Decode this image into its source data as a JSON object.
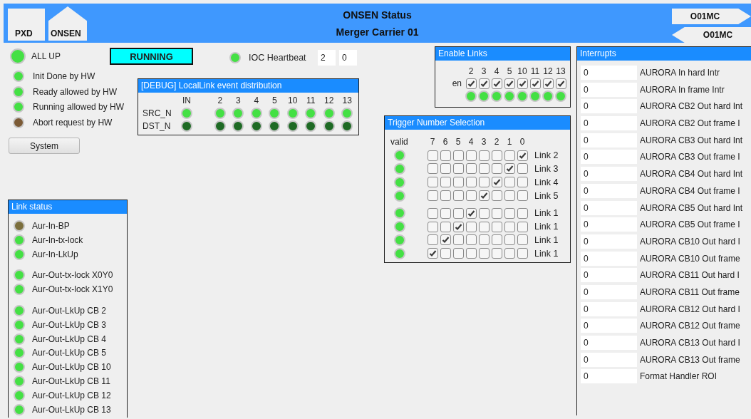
{
  "header": {
    "buttons": [
      {
        "kind": "square",
        "label": "PXD"
      },
      {
        "kind": "house",
        "label": "ONSEN"
      }
    ],
    "title": "ONSEN Status",
    "subtitle": "Merger Carrier 01",
    "nav": [
      {
        "kind": "next",
        "label": "O01MC"
      },
      {
        "kind": "prev",
        "label": "O01MC"
      }
    ]
  },
  "status": {
    "all_up": {
      "label": "ALL UP",
      "color": "#44e044"
    },
    "state": "RUNNING",
    "indicators": [
      {
        "label": "Init Done by HW",
        "color": "#44e044"
      },
      {
        "label": "Ready allowed by HW",
        "color": "#44e044"
      },
      {
        "label": "Running allowed by HW",
        "color": "#44e044"
      },
      {
        "label": "Abort request by HW",
        "color": "#7b5a35"
      }
    ],
    "button": "System"
  },
  "heartbeat": {
    "label": "IOC Heartbeat",
    "color": "#44e044",
    "values": [
      "2",
      "0"
    ]
  },
  "debug_panel": {
    "title": "[DEBUG] LocalLink event distribution",
    "columns": [
      "IN",
      "2",
      "3",
      "4",
      "5",
      "10",
      "11",
      "12",
      "13"
    ],
    "rows": [
      {
        "label": "SRC_N",
        "leds": [
          {
            "color": "#44e044"
          },
          {
            "color": "#44e044"
          },
          {
            "color": "#44e044"
          },
          {
            "color": "#44e044"
          },
          {
            "color": "#44e044"
          },
          {
            "color": "#44e044"
          },
          {
            "color": "#44e044"
          },
          {
            "color": "#44e044"
          },
          {
            "color": "#44e044"
          }
        ]
      },
      {
        "label": "DST_N",
        "leds": [
          {
            "color": "#1e6a24"
          },
          {
            "color": "#1e6a24"
          },
          {
            "color": "#1e6a24"
          },
          {
            "color": "#1e6a24"
          },
          {
            "color": "#1e6a24"
          },
          {
            "color": "#1e6a24"
          },
          {
            "color": "#1e6a24"
          },
          {
            "color": "#1e6a24"
          },
          {
            "color": "#1e6a24"
          }
        ]
      }
    ]
  },
  "link_status": {
    "title": "Link status",
    "groups": [
      [
        {
          "label": "Aur-In-BP",
          "color": "#7b6e3c"
        },
        {
          "label": "Aur-In-tx-lock",
          "color": "#44e044"
        },
        {
          "label": "Aur-In-LkUp",
          "color": "#44e044"
        }
      ],
      [
        {
          "label": "Aur-Out-tx-lock X0Y0",
          "color": "#44e044"
        },
        {
          "label": "Aur-Out-tx-lock X1Y0",
          "color": "#44e044"
        }
      ],
      [
        {
          "label": "Aur-Out-LkUp CB 2",
          "color": "#44e044"
        },
        {
          "label": "Aur-Out-LkUp CB 3",
          "color": "#44e044"
        },
        {
          "label": "Aur-Out-LkUp CB 4",
          "color": "#44e044"
        },
        {
          "label": "Aur-Out-LkUp CB 5",
          "color": "#44e044"
        },
        {
          "label": "Aur-Out-LkUp CB 10",
          "color": "#44e044"
        },
        {
          "label": "Aur-Out-LkUp CB 11",
          "color": "#44e044"
        },
        {
          "label": "Aur-Out-LkUp CB 12",
          "color": "#44e044"
        },
        {
          "label": "Aur-Out-LkUp CB 13",
          "color": "#44e044"
        }
      ]
    ]
  },
  "enable_links": {
    "title": "Enable Links",
    "row_label": "en",
    "links": [
      {
        "label": "2",
        "checked": true,
        "color": "#44e044"
      },
      {
        "label": "3",
        "checked": true,
        "color": "#44e044"
      },
      {
        "label": "4",
        "checked": true,
        "color": "#44e044"
      },
      {
        "label": "5",
        "checked": true,
        "color": "#44e044"
      },
      {
        "label": "10",
        "checked": true,
        "color": "#44e044"
      },
      {
        "label": "11",
        "checked": true,
        "color": "#44e044"
      },
      {
        "label": "12",
        "checked": true,
        "color": "#44e044"
      },
      {
        "label": "13",
        "checked": true,
        "color": "#44e044"
      }
    ]
  },
  "trigger_selection": {
    "title": "Trigger Number Selection",
    "valid_label": "valid",
    "bits": [
      "7",
      "6",
      "5",
      "4",
      "3",
      "2",
      "1",
      "0"
    ],
    "groups": [
      [
        {
          "label": "Link 2",
          "color": "#44e044",
          "checked": [
            false,
            false,
            false,
            false,
            false,
            false,
            false,
            true
          ]
        },
        {
          "label": "Link 3",
          "color": "#44e044",
          "checked": [
            false,
            false,
            false,
            false,
            false,
            false,
            true,
            false
          ]
        },
        {
          "label": "Link 4",
          "color": "#44e044",
          "checked": [
            false,
            false,
            false,
            false,
            false,
            true,
            false,
            false
          ]
        },
        {
          "label": "Link 5",
          "color": "#44e044",
          "checked": [
            false,
            false,
            false,
            false,
            true,
            false,
            false,
            false
          ]
        }
      ],
      [
        {
          "label": "Link 1",
          "color": "#44e044",
          "checked": [
            false,
            false,
            false,
            true,
            false,
            false,
            false,
            false
          ]
        },
        {
          "label": "Link 1",
          "color": "#44e044",
          "checked": [
            false,
            false,
            true,
            false,
            false,
            false,
            false,
            false
          ]
        },
        {
          "label": "Link 1",
          "color": "#44e044",
          "checked": [
            false,
            true,
            false,
            false,
            false,
            false,
            false,
            false
          ]
        },
        {
          "label": "Link 1",
          "color": "#44e044",
          "checked": [
            true,
            false,
            false,
            false,
            false,
            false,
            false,
            false
          ]
        }
      ]
    ]
  },
  "interrupts": {
    "title": "Interrupts",
    "rows": [
      {
        "value": "0",
        "label": "AURORA In hard Intr"
      },
      {
        "value": "0",
        "label": "AURORA In frame Intr"
      },
      {
        "value": "0",
        "label": "AURORA CB2 Out hard Int"
      },
      {
        "value": "0",
        "label": "AURORA CB2 Out frame I"
      },
      {
        "value": "0",
        "label": "AURORA CB3 Out hard Int"
      },
      {
        "value": "0",
        "label": "AURORA CB3 Out frame I"
      },
      {
        "value": "0",
        "label": "AURORA CB4 Out hard Int"
      },
      {
        "value": "0",
        "label": "AURORA CB4 Out frame I"
      },
      {
        "value": "0",
        "label": "AURORA CB5 Out hard Int"
      },
      {
        "value": "0",
        "label": "AURORA CB5 Out frame I"
      },
      {
        "value": "0",
        "label": "AURORA CB10 Out hard I"
      },
      {
        "value": "0",
        "label": "AURORA CB10 Out frame"
      },
      {
        "value": "0",
        "label": "AURORA CB11 Out hard I"
      },
      {
        "value": "0",
        "label": "AURORA CB11 Out frame"
      },
      {
        "value": "0",
        "label": "AURORA CB12 Out hard I"
      },
      {
        "value": "0",
        "label": "AURORA CB12 Out frame"
      },
      {
        "value": "0",
        "label": "AURORA CB13 Out hard I"
      },
      {
        "value": "0",
        "label": "AURORA CB13 Out frame"
      },
      {
        "value": "0",
        "label": "Format Handler ROI"
      }
    ]
  }
}
